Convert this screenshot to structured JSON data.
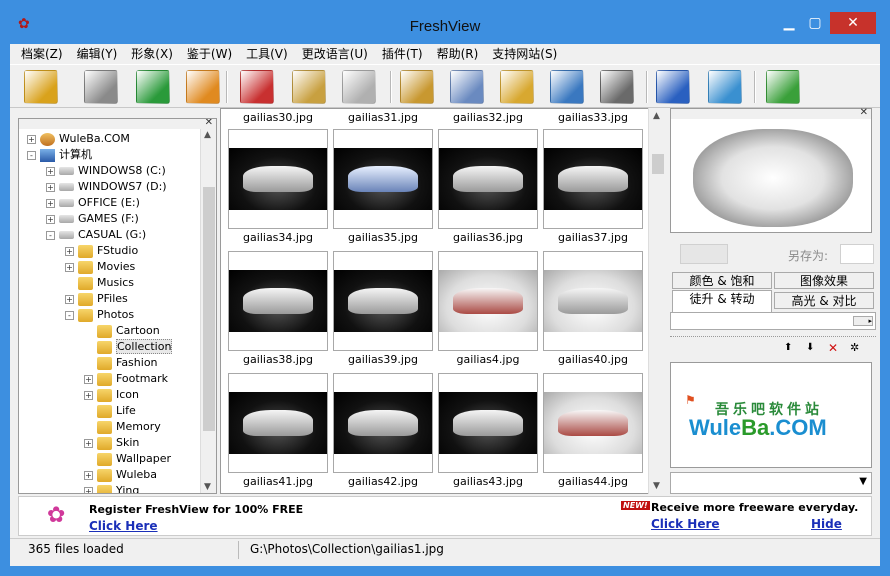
{
  "window": {
    "title": "FreshView"
  },
  "menu": [
    "档案(Z)",
    "编辑(Y)",
    "形象(X)",
    "鉴于(W)",
    "工具(V)",
    "更改语言(U)",
    "插件(T)",
    "帮助(R)",
    "支持网站(S)"
  ],
  "toolbar": [
    {
      "icon": "folder-book-icon",
      "color": "#d9a21c"
    },
    {
      "icon": "gray-book-icon",
      "color": "#8a8a8a"
    },
    {
      "icon": "refresh-icon",
      "color": "#2a9a3a"
    },
    {
      "icon": "home-icon",
      "color": "#e08a20"
    },
    {
      "icon": "scissors-icon",
      "color": "#c83030"
    },
    {
      "icon": "clipboard-icon",
      "color": "#c8a040"
    },
    {
      "icon": "copy-icon",
      "color": "#b0b0b0"
    },
    {
      "icon": "paste-image-icon",
      "color": "#c89830"
    },
    {
      "icon": "image-grid-icon",
      "color": "#6a8ac0"
    },
    {
      "icon": "image-folder-icon",
      "color": "#d8a830"
    },
    {
      "icon": "folder-pin-icon",
      "color": "#3a78c0"
    },
    {
      "icon": "printer-icon",
      "color": "#6a6a6a"
    },
    {
      "icon": "checklist-icon",
      "color": "#2a60c0"
    },
    {
      "icon": "chart-image-icon",
      "color": "#3a90d0"
    },
    {
      "icon": "plugin-gear-icon",
      "color": "#3aa03a"
    }
  ],
  "tree": [
    {
      "label": "WuleBa.COM",
      "level": 0,
      "type": "user",
      "pm": "+"
    },
    {
      "label": "计算机",
      "level": 0,
      "type": "computer",
      "pm": "-"
    },
    {
      "label": "WINDOWS8 (C:)",
      "level": 1,
      "type": "drive",
      "pm": "+"
    },
    {
      "label": "WINDOWS7 (D:)",
      "level": 1,
      "type": "drive",
      "pm": "+"
    },
    {
      "label": "OFFICE (E:)",
      "level": 1,
      "type": "drive",
      "pm": "+"
    },
    {
      "label": "GAMES (F:)",
      "level": 1,
      "type": "drive",
      "pm": "+"
    },
    {
      "label": "CASUAL (G:)",
      "level": 1,
      "type": "drive",
      "pm": "-"
    },
    {
      "label": "FStudio",
      "level": 2,
      "type": "folder",
      "pm": "+"
    },
    {
      "label": "Movies",
      "level": 2,
      "type": "folder",
      "pm": "+"
    },
    {
      "label": "Musics",
      "level": 2,
      "type": "folder",
      "pm": ""
    },
    {
      "label": "PFiles",
      "level": 2,
      "type": "folder",
      "pm": "+"
    },
    {
      "label": "Photos",
      "level": 2,
      "type": "folder",
      "pm": "-"
    },
    {
      "label": "Cartoon",
      "level": 3,
      "type": "folder",
      "pm": ""
    },
    {
      "label": "Collection",
      "level": 3,
      "type": "folder",
      "pm": "",
      "selected": true
    },
    {
      "label": "Fashion",
      "level": 3,
      "type": "folder",
      "pm": ""
    },
    {
      "label": "Footmark",
      "level": 3,
      "type": "folder",
      "pm": "+"
    },
    {
      "label": "Icon",
      "level": 3,
      "type": "folder",
      "pm": "+"
    },
    {
      "label": "Life",
      "level": 3,
      "type": "folder",
      "pm": ""
    },
    {
      "label": "Memory",
      "level": 3,
      "type": "folder",
      "pm": ""
    },
    {
      "label": "Skin",
      "level": 3,
      "type": "folder",
      "pm": "+"
    },
    {
      "label": "Wallpaper",
      "level": 3,
      "type": "folder",
      "pm": ""
    },
    {
      "label": "Wuleba",
      "level": 3,
      "type": "folder",
      "pm": "+"
    },
    {
      "label": "Ying",
      "level": 3,
      "type": "folder",
      "pm": "+"
    }
  ],
  "thumbs": {
    "top_captions": [
      "gailias30.jpg",
      "gailias31.jpg",
      "gailias32.jpg",
      "gailias33.jpg"
    ],
    "rows": [
      [
        {
          "name": "gailias34.jpg",
          "bg": "dark",
          "car": ""
        },
        {
          "name": "gailias35.jpg",
          "bg": "dark",
          "car": "blue"
        },
        {
          "name": "gailias36.jpg",
          "bg": "dark",
          "car": ""
        },
        {
          "name": "gailias37.jpg",
          "bg": "dark",
          "car": ""
        }
      ],
      [
        {
          "name": "gailias38.jpg",
          "bg": "dark",
          "car": ""
        },
        {
          "name": "gailias39.jpg",
          "bg": "dark",
          "car": ""
        },
        {
          "name": "gailias4.jpg",
          "bg": "light",
          "car": "red"
        },
        {
          "name": "gailias40.jpg",
          "bg": "light",
          "car": ""
        }
      ],
      [
        {
          "name": "gailias41.jpg",
          "bg": "dark",
          "car": ""
        },
        {
          "name": "gailias42.jpg",
          "bg": "dark",
          "car": ""
        },
        {
          "name": "gailias43.jpg",
          "bg": "dark",
          "car": ""
        },
        {
          "name": "gailias44.jpg",
          "bg": "light",
          "car": "red"
        }
      ]
    ]
  },
  "preview": {
    "saveas_label": "另存为:"
  },
  "tabs": {
    "row1": [
      "颜色 & 饱和",
      "图像效果"
    ],
    "row2": [
      "徒升 & 转动",
      "高光 & 对比"
    ]
  },
  "logo": {
    "cn": "吾乐吧软件站",
    "en_pre": "Wule",
    "en_mid": "Ba",
    "en_post": ".COM"
  },
  "ad": {
    "left_text": "Register FreshView for 100% FREE",
    "left_link": "Click Here",
    "new_badge": "NEW!",
    "right_text": "Receive more freeware everyday.",
    "right_link": "Click Here",
    "hide": "Hide"
  },
  "status": {
    "count": "365 files loaded",
    "path": "G:\\Photos\\Collection\\gailias1.jpg"
  }
}
